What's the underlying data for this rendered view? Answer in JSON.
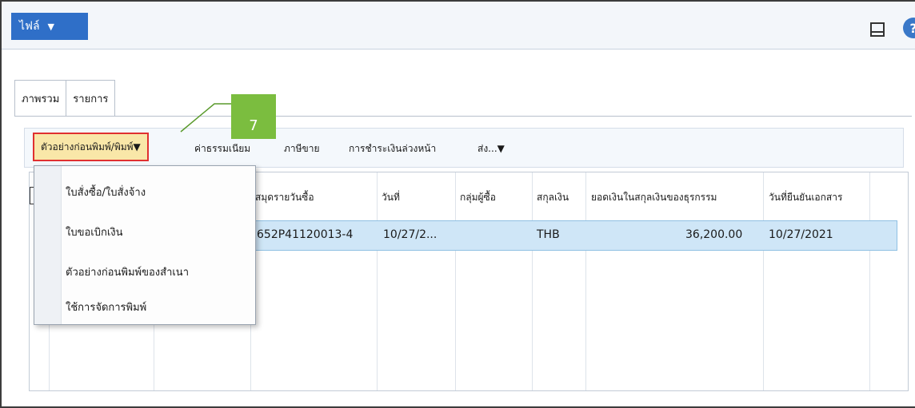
{
  "topbar": {
    "file_label": "ไฟล์",
    "file_caret": "▼",
    "help_glyph": "?"
  },
  "tabs": [
    {
      "label": "ภาพรวม"
    },
    {
      "label": "รายการ"
    }
  ],
  "toolbar": {
    "preview_print": "ตัวอย่างก่อนพิมพ์/พิมพ์▼",
    "fees": "ค่าธรรมเนียม",
    "tax": "ภาษีขาย",
    "prepayment": "การชำระเงินล่วงหน้า",
    "send": "ส่ง...▼"
  },
  "callout": {
    "number": "7"
  },
  "grid": {
    "columns": [
      "สมุดรายวันซื้อ",
      "วันที่",
      "กลุ่มผู้ซื้อ",
      "สกุลเงิน",
      "ยอดเงินในสกุลเงินของธุรกรรม",
      "วันที่ยืนยันเอกสาร"
    ],
    "rows": [
      {
        "journal": "652P41120013-4",
        "date": "10/27/2...",
        "group": "",
        "currency": "THB",
        "amount": "36,200.00",
        "confirm_date": "10/27/2021"
      }
    ]
  },
  "menu": {
    "items": [
      {
        "label": "ใบสั่งซื้อ/ใบสั่งจ้าง"
      },
      {
        "label": "ใบขอเบิกเงิน"
      },
      {
        "label": "ตัวอย่างก่อนพิมพ์ของสำเนา"
      },
      {
        "label": "ใช้การจัดการพิมพ์"
      }
    ]
  },
  "colors": {
    "file_button": "#2f6fc8",
    "highlight": "#f9e7a8",
    "highlight_border": "#e03030",
    "callout": "#7bbd3f",
    "selected_row": "#cfe6f7"
  }
}
